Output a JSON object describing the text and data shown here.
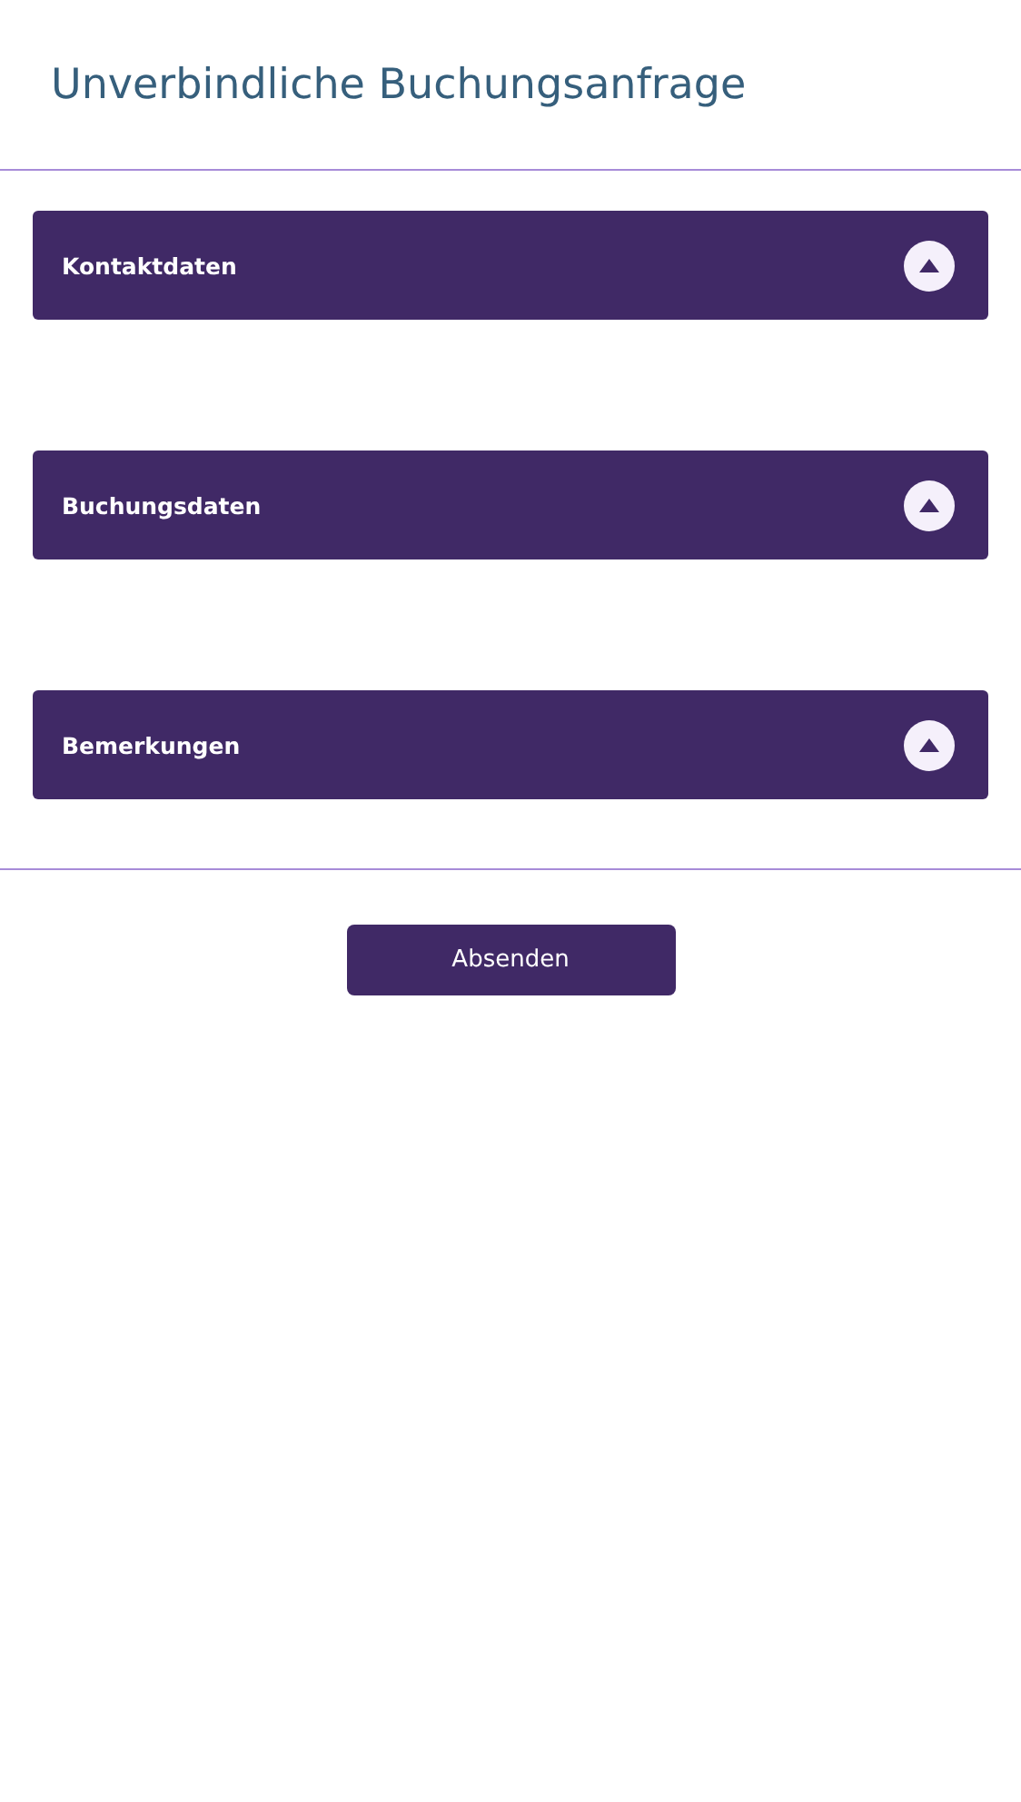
{
  "title": "Unverbindliche Buchungsanfrage",
  "sections": [
    {
      "label": "Kontaktdaten",
      "expanded": false
    },
    {
      "label": "Buchungsdaten",
      "expanded": false
    },
    {
      "label": "Bemerkungen",
      "expanded": false
    }
  ],
  "submit_button": {
    "label": "Absenden"
  }
}
